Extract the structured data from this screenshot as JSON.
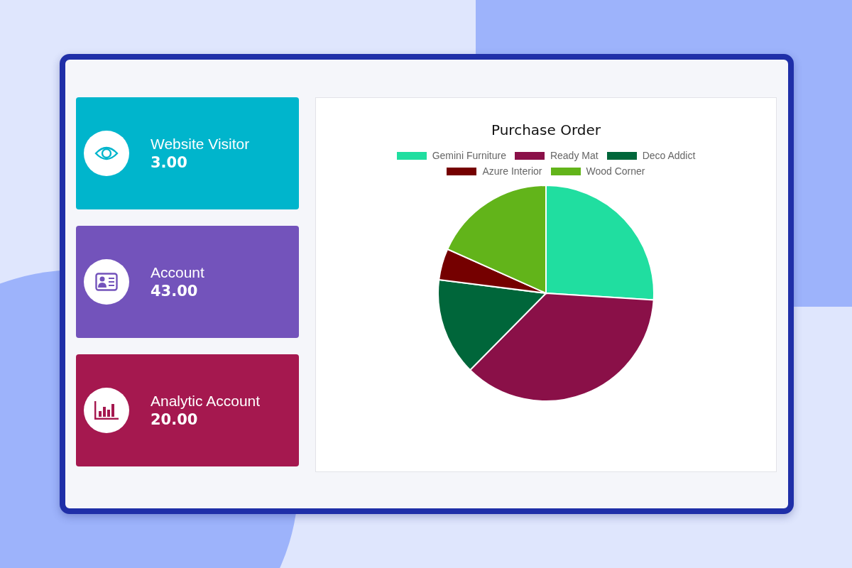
{
  "cards": [
    {
      "kind": "visitor",
      "title": "Website Visitor",
      "value": "3.00",
      "color": "#00b5cc"
    },
    {
      "kind": "account",
      "title": "Account",
      "value": "43.00",
      "color": "#7353bb"
    },
    {
      "kind": "analytic",
      "title": "Analytic Account",
      "value": "20.00",
      "color": "#a5184f"
    }
  ],
  "chart": {
    "title": "Purchase Order",
    "legend": [
      {
        "label": "Gemini Furniture",
        "color": "#20dea0"
      },
      {
        "label": "Ready Mat",
        "color": "#8a1048"
      },
      {
        "label": "Deco Addict",
        "color": "#00663a"
      },
      {
        "label": "Azure Interior",
        "color": "#750000"
      },
      {
        "label": "Wood Corner",
        "color": "#62b41a"
      }
    ]
  }
}
